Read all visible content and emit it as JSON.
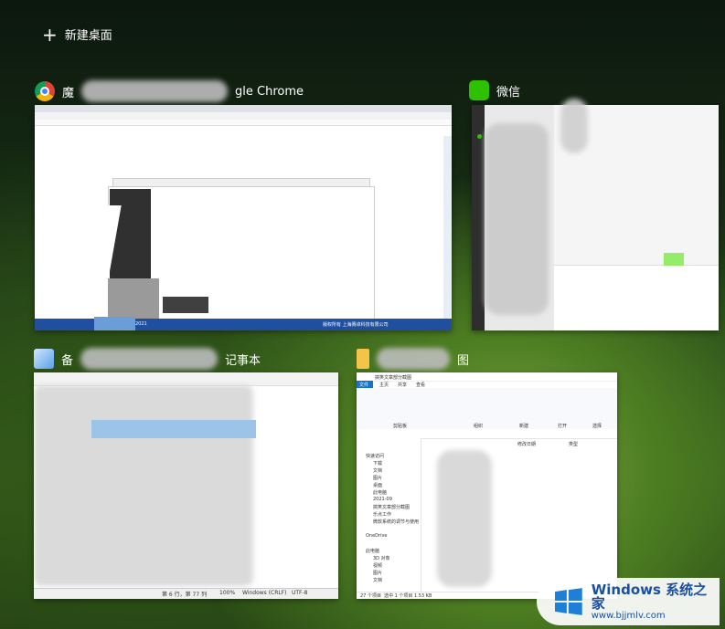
{
  "new_desktop": {
    "label": "新建桌面"
  },
  "windows": [
    {
      "title_start": "魔",
      "title_end": "gle Chrome",
      "app": "chrome",
      "footer_left": "2021",
      "footer_right": "版权所有 上海赛卓科技有限公司"
    },
    {
      "title_start": "微信",
      "title_end": "",
      "app": "wechat"
    },
    {
      "title_start": "备",
      "title_end": "记事本",
      "app": "notepad",
      "status": {
        "position": "第 6 行，第 77 列",
        "zoom": "100%",
        "eol": "Windows (CRLF)",
        "encoding": "UTF-8"
      }
    },
    {
      "title_start": "",
      "title_end": "图",
      "app": "explorer",
      "path": "搞笑文章部分截图",
      "ribbon_tabs": [
        "文件",
        "主页",
        "共享",
        "查看"
      ],
      "groups": [
        "剪贴板",
        "组织",
        "新建",
        "打开",
        "选择"
      ],
      "nav_items": [
        "快速访问",
        "下载",
        "文档",
        "图片",
        "桌面",
        "此电脑",
        "2021-09",
        "搞笑文章部分截图",
        "乐点工作",
        "微软系统的调节与使用",
        "OneDrive",
        "此电脑",
        "3D 对象",
        "视频",
        "图片",
        "文档"
      ],
      "col_date": "修改日期",
      "col_type": "类型",
      "status_left": "27 个项目",
      "status_mid": "选中 1 个项目 1.53 KB"
    }
  ],
  "watermark": {
    "brand": "Windows 系统之家",
    "url": "www.bjjmlv.com"
  }
}
